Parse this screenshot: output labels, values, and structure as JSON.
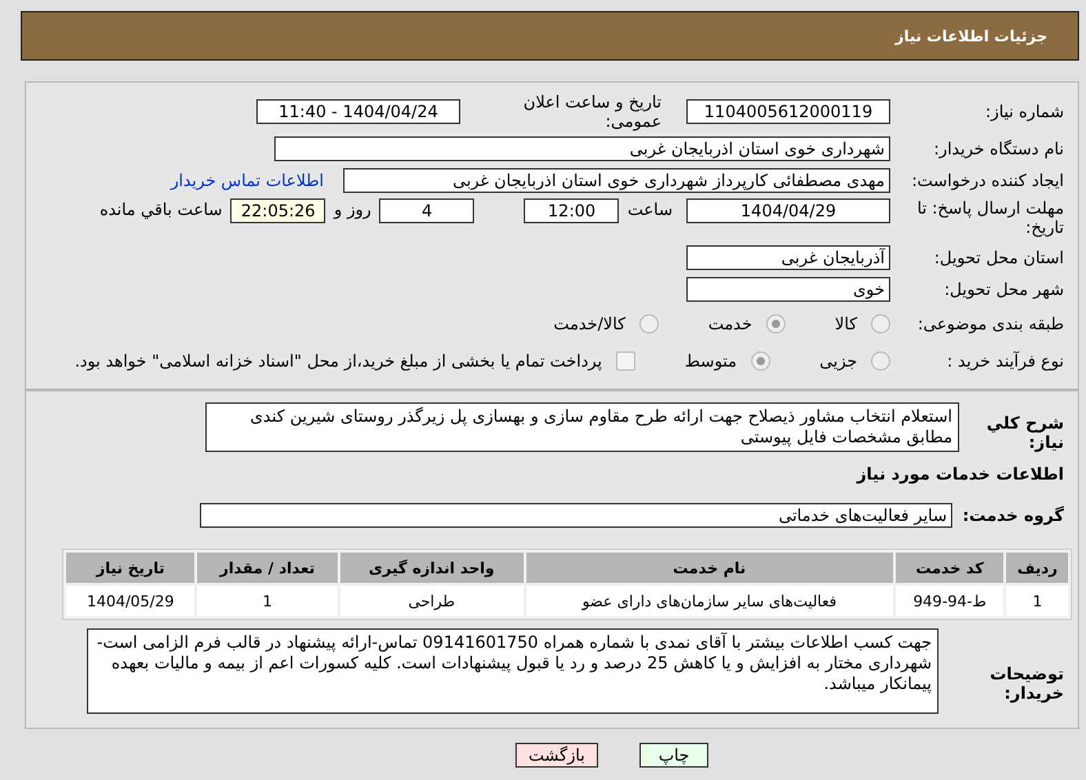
{
  "header": {
    "title": "جزئیات اطلاعات نیاز"
  },
  "need_info": {
    "need_number": {
      "label": "شماره نیاز:",
      "value": "1104005612000119"
    },
    "announce": {
      "label": "تاریخ و ساعت اعلان عمومی:",
      "value": "1404/04/24 - 11:40"
    },
    "buyer_org": {
      "label": "نام دستگاه خریدار:",
      "value": "شهرداری خوی استان اذربایجان غربی"
    },
    "requester": {
      "label": "ایجاد کننده درخواست:",
      "value": "مهدی مصطفائی کارپرداز شهرداری خوی استان اذربایجان غربی",
      "link": "اطلاعات تماس خریدار"
    },
    "deadline": {
      "label": "مهلت ارسال پاسخ: تا تاریخ:",
      "date": "1404/04/29",
      "time_label": "ساعت",
      "time": "12:00",
      "days": "4",
      "days_label": "روز و",
      "remaining": "22:05:26",
      "remaining_label": "ساعت باقي مانده"
    },
    "province": {
      "label": "استان محل تحویل:",
      "value": "آذربایجان غربی"
    },
    "city": {
      "label": "شهر محل تحویل:",
      "value": "خوی"
    },
    "category": {
      "label": "طبقه بندی موضوعی:",
      "options": [
        {
          "label": "کالا",
          "selected": false
        },
        {
          "label": "خدمت",
          "selected": true
        },
        {
          "label": "کالا/خدمت",
          "selected": false
        }
      ]
    },
    "purchase_type": {
      "label": "نوع فرآیند خرید :",
      "options": [
        {
          "label": "جزیی",
          "selected": false
        },
        {
          "label": "متوسط",
          "selected": true
        }
      ],
      "payment_note": {
        "label": "پرداخت تمام یا بخشی از مبلغ خرید،از محل \"اسناد خزانه اسلامی\" خواهد بود.",
        "checked": false
      }
    }
  },
  "description": {
    "label": "شرح کلي نياز:",
    "value": "استعلام انتخاب مشاور ذیصلاح جهت ارائه طرح مقاوم سازی و بهسازی پل زیرگذر روستای شیرین کندی مطابق مشخصات فایل پیوستی"
  },
  "services_title": "اطلاعات خدمات مورد نیاز",
  "service_group": {
    "label": "گروه خدمت:",
    "value": "سایر فعالیت‌های خدماتی"
  },
  "table": {
    "columns": [
      "ردیف",
      "کد خدمت",
      "نام خدمت",
      "واحد اندازه گیری",
      "تعداد / مقدار",
      "تاریخ نیاز"
    ],
    "rows": [
      [
        "1",
        "ط-94-949",
        "فعالیت‌های سایر سازمان‌های دارای عضو",
        "طراحی",
        "1",
        "1404/05/29"
      ]
    ]
  },
  "buyer_notes": {
    "label": "توضیحات خریدار:",
    "value": "جهت کسب اطلاعات بیشتر با آقای نمدی با شماره همراه 09141601750 تماس-ارائه پیشنهاد در قالب فرم الزامی است-شهرداری مختار به افزایش و یا کاهش 25 درصد و رد یا قبول پیشنهادات است. کلیه کسورات اعم از بیمه و مالیات بعهده پیمانکار میباشد."
  },
  "buttons": [
    {
      "label": "چاپ",
      "kind": "print"
    },
    {
      "label": "بازگشت",
      "kind": "back"
    }
  ]
}
